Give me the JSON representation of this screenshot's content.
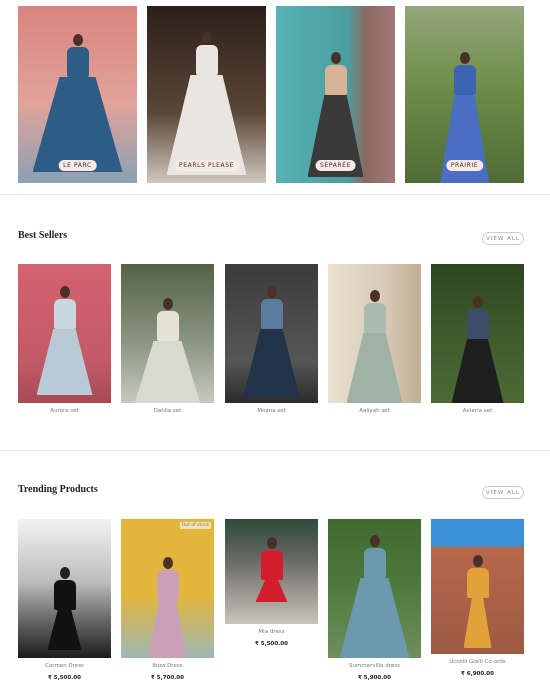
{
  "collections": [
    {
      "label": "LE PARC",
      "bg": "#d9847e",
      "dress": "#2d5d86"
    },
    {
      "label": "PEARLS PLEASE",
      "bg": "#3a2d24",
      "dress": "#e9e6e1"
    },
    {
      "label": "SEPARÉE",
      "bg": "#4fa3a6",
      "dress": "#3a3a3a"
    },
    {
      "label": "PRAIRIE",
      "bg": "#6e8d4a",
      "dress": "#3d63b5"
    }
  ],
  "best_sellers": {
    "title": "Best Sellers",
    "view_all": "VIEW ALL",
    "items": [
      {
        "name": "Aurora set",
        "bg": "#d46270",
        "dress": "#b9cad6"
      },
      {
        "name": "Dahlia set",
        "bg": "#6d7a5e",
        "dress": "#d8d9cf"
      },
      {
        "name": "Moana set",
        "bg": "#4a4a4a",
        "dress": "#20334a"
      },
      {
        "name": "Aaliyah set",
        "bg": "#d8cbb7",
        "dress": "#9fb2a4"
      },
      {
        "name": "Asteria set",
        "bg": "#3f5a2c",
        "dress": "#1e1e1e"
      }
    ]
  },
  "trending": {
    "title": "Trending Products",
    "view_all": "VIEW ALL",
    "out_of_stock": "Out of stock",
    "items": [
      {
        "name": "Carmen Dress",
        "price": "₹ 5,500.00",
        "bg": "#9a9a9a",
        "dress": "#111111"
      },
      {
        "name": "Ibiza Dress",
        "price": "₹ 5,700.00",
        "bg": "#e1b63a",
        "dress": "#c9a0b7"
      },
      {
        "name": "Mia dress",
        "price": "₹ 5,500.00",
        "bg": "#7c7c78",
        "dress": "#d31c2e"
      },
      {
        "name": "Summerville dress",
        "price": "₹ 5,900.00",
        "bg": "#4f7a3e",
        "dress": "#6b99ad"
      },
      {
        "name": "Uccelli Gialli Co-ords",
        "price": "₹ 6,900.00",
        "bg": "#b7684c",
        "dress": "#e2a23a"
      }
    ]
  }
}
